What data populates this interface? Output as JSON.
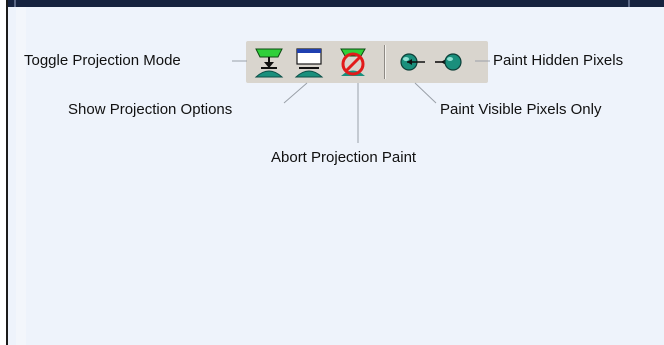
{
  "callouts": {
    "toggle_projection_mode": "Toggle Projection Mode",
    "show_projection_options": "Show Projection Options",
    "abort_projection_paint": "Abort Projection Paint",
    "paint_visible_pixels_only": "Paint Visible Pixels Only",
    "paint_hidden_pixels": "Paint Hidden Pixels"
  },
  "toolbar": {
    "buttons": [
      {
        "icon": "toggle-projection-mode-icon"
      },
      {
        "icon": "show-projection-options-icon"
      },
      {
        "icon": "abort-projection-paint-icon"
      },
      {
        "icon": "paint-visible-pixels-only-icon"
      },
      {
        "icon": "paint-hidden-pixels-icon"
      }
    ]
  },
  "colors": {
    "toolbar_bg": "#d9d5ce",
    "panel_bg": "#eef3fb",
    "titlebar": "#16233f",
    "icon_teal": "#1a8f7c",
    "icon_green": "#2fcf3a",
    "icon_red": "#e21a1a",
    "icon_blue": "#1f3fb0"
  }
}
